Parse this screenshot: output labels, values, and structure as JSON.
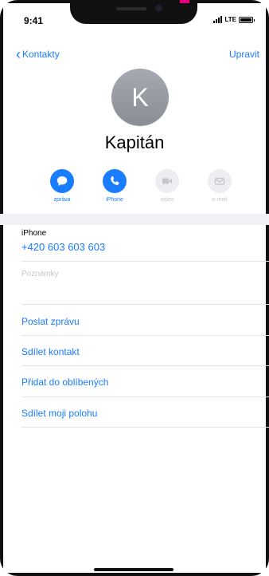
{
  "status": {
    "time": "9:41",
    "network": "LTE"
  },
  "nav": {
    "back_label": "Kontakty",
    "edit_label": "Upravit"
  },
  "contact": {
    "initial": "K",
    "name": "Kapitán"
  },
  "actions": [
    {
      "label": "zpráva",
      "icon": "message-icon",
      "enabled": true
    },
    {
      "label": "iPhone",
      "icon": "phone-icon",
      "enabled": true
    },
    {
      "label": "video",
      "icon": "video-icon",
      "enabled": false
    },
    {
      "label": "e-mail",
      "icon": "mail-icon",
      "enabled": false
    }
  ],
  "phone": {
    "label": "iPhone",
    "number": "+420 603 603 603"
  },
  "notes": {
    "placeholder": "Poznámky"
  },
  "links": [
    "Poslat zprávu",
    "Sdílet kontakt",
    "Přidat do oblíbených",
    "Sdílet moji polohu"
  ],
  "colors": {
    "accent": "#1a7cff",
    "avatar": "#9a9ca3",
    "brand_mark": "#e6007e"
  }
}
